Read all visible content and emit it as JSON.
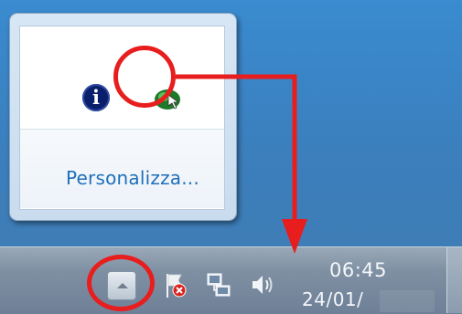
{
  "popup": {
    "customize_label": "Personalizza...",
    "info_icon_glyph": "i"
  },
  "tray": {
    "time": "06:45",
    "date": "24/01/"
  },
  "icons": {
    "info": "info-icon",
    "app": "green-app-icon",
    "chevron": "chevron-up-icon",
    "action_center": "action-center-flag-icon",
    "network": "network-icon",
    "volume": "volume-icon"
  },
  "colors": {
    "callout": "#e81d1d",
    "link": "#1f6fba",
    "desktop": "#3a8bd0",
    "taskbar": "#7f90a3"
  }
}
